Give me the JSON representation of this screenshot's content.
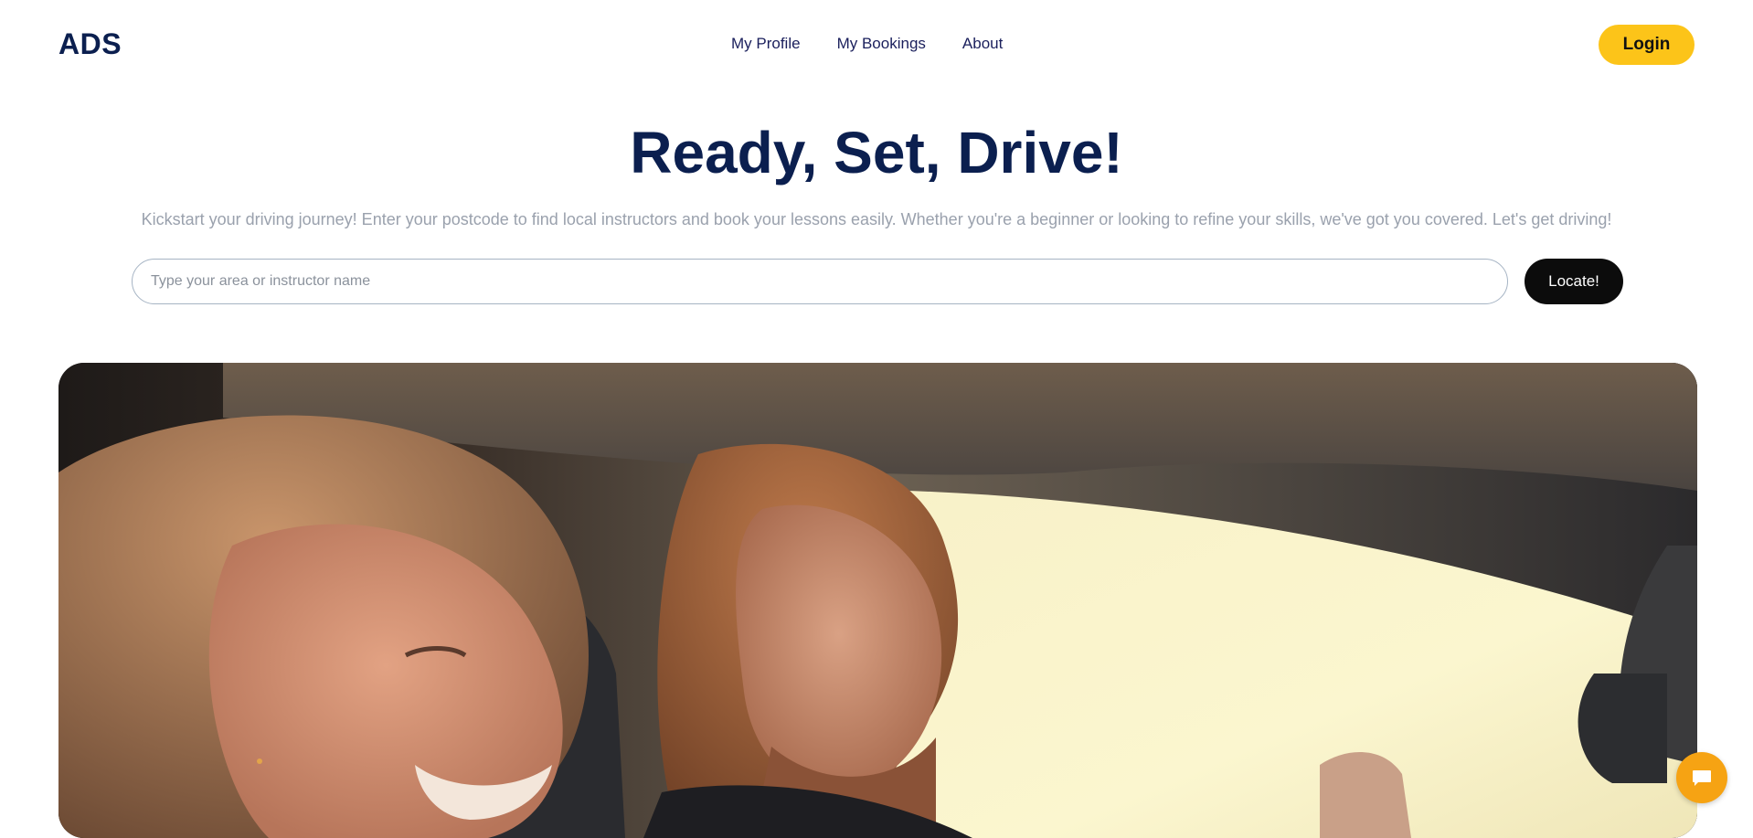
{
  "header": {
    "logo": "ADS",
    "nav": [
      {
        "label": "My Profile"
      },
      {
        "label": "My Bookings"
      },
      {
        "label": "About"
      }
    ],
    "login_label": "Login"
  },
  "hero": {
    "title": "Ready, Set, Drive!",
    "subtitle": "Kickstart your driving journey! Enter your postcode to find local instructors and book your lessons easily. Whether you're a beginner or looking to refine your skills, we've got you covered. Let's get driving!",
    "search_placeholder": "Type your area or instructor name",
    "search_value": "",
    "locate_label": "Locate!"
  },
  "image": {
    "icon": "photo-woman-and-man-in-car"
  },
  "chat": {
    "icon": "chat-bubble-icon"
  },
  "colors": {
    "brand_navy": "#0b1f4f",
    "login_yellow": "#fcc419",
    "chat_orange": "#f6a313",
    "locate_black": "#0c0c0c"
  }
}
